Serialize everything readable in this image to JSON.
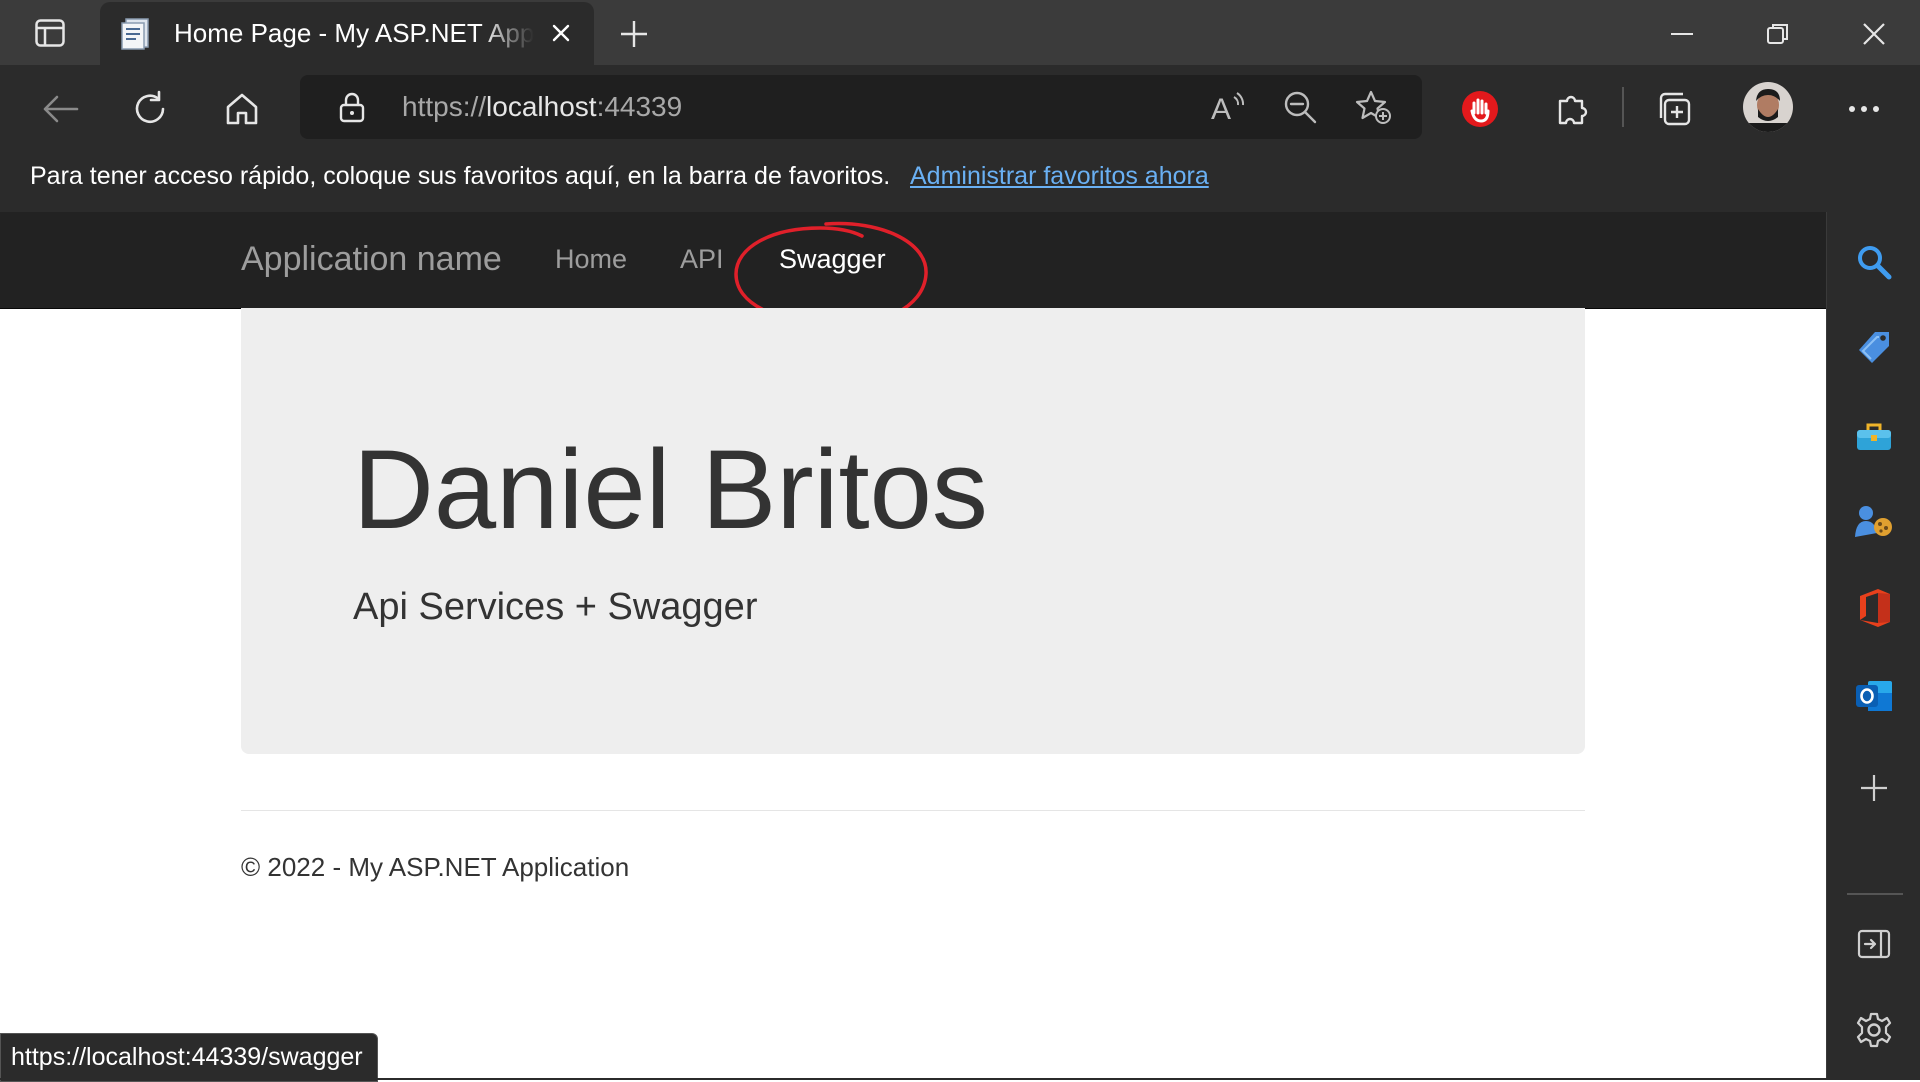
{
  "browser": {
    "tab_title": "Home Page - My ASP.NET Application",
    "url_scheme": "https://",
    "url_host": "localhost",
    "url_port": ":44339",
    "favorites_bar_text": "Para tener acceso rápido, coloque sus favoritos aquí, en la barra de favoritos.",
    "favorites_bar_link": "Administrar favoritos ahora",
    "status_url": "https://localhost:44339/swagger"
  },
  "site": {
    "brand": "Application name",
    "nav": [
      {
        "label": "Home"
      },
      {
        "label": "API"
      },
      {
        "label": "Swagger",
        "active": true
      }
    ],
    "jumbotron": {
      "title": "Daniel Britos",
      "lead": "Api Services + Swagger"
    },
    "footer": "© 2022 - My ASP.NET Application"
  },
  "icons": {
    "titlebar": [
      "tab-actions-icon",
      "page-favicon-icon",
      "close-tab-icon",
      "new-tab-icon",
      "minimize-icon",
      "restore-icon",
      "close-window-icon"
    ],
    "toolbar": [
      "back-icon",
      "refresh-icon",
      "home-icon",
      "lock-icon",
      "read-aloud-icon",
      "zoom-out-icon",
      "add-favorite-icon",
      "adblock-icon",
      "extensions-icon",
      "collections-icon",
      "profile-avatar",
      "more-icon"
    ],
    "sidebar": [
      "search-icon",
      "shopping-tag-icon",
      "tools-icon",
      "games-icon",
      "office-icon",
      "outlook-icon",
      "add-icon",
      "hide-sidebar-icon",
      "settings-icon"
    ]
  },
  "colors": {
    "chrome_dark": "#2b2b2b",
    "titlebar": "#3b3b3b",
    "site_navbar": "#222222",
    "jumbotron_bg": "#eeeeee",
    "link": "#6ab0f3",
    "highlight_ring": "#e0202a"
  }
}
